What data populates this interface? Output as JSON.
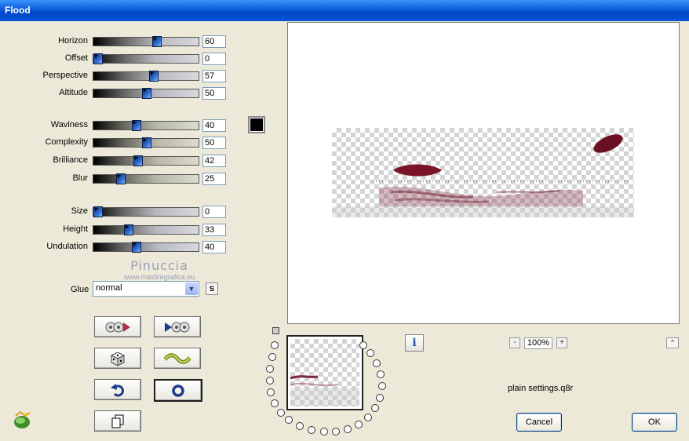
{
  "window": {
    "title": "Flood"
  },
  "params": [
    {
      "label": "Horizon",
      "value": "60",
      "level": 0.6
    },
    {
      "label": "Offset",
      "value": "0",
      "level": 0.0
    },
    {
      "label": "Perspective",
      "value": "57",
      "level": 0.57
    },
    {
      "label": "Altitude",
      "value": "50",
      "level": 0.5
    },
    {
      "label": "Waviness",
      "value": "40",
      "level": 0.4
    },
    {
      "label": "Complexity",
      "value": "50",
      "level": 0.5
    },
    {
      "label": "Brilliance",
      "value": "42",
      "level": 0.42
    },
    {
      "label": "Blur",
      "value": "25",
      "level": 0.25
    },
    {
      "label": "Size",
      "value": "0",
      "level": 0.0
    },
    {
      "label": "Height",
      "value": "33",
      "level": 0.33
    },
    {
      "label": "Undulation",
      "value": "40",
      "level": 0.4
    }
  ],
  "color_swatch": "#000000",
  "watermark": {
    "name": "Pinuccia",
    "url": "www.maidiregrafica.eu"
  },
  "glue": {
    "label": "Glue",
    "value": "normal",
    "s_label": "S"
  },
  "tool_buttons": [
    "prev-preset-icon",
    "next-preset-icon",
    "randomize-dice-icon",
    "wave-icon",
    "reset-arrow-icon",
    "circle-icon",
    "copy-pages-icon"
  ],
  "zoom": {
    "value": "100%",
    "minus": "-",
    "plus": "+"
  },
  "info_label": "i",
  "collapse_label": "^",
  "settings_file": "plain settings.q8r",
  "buttons": {
    "cancel": "Cancel",
    "ok": "OK"
  }
}
